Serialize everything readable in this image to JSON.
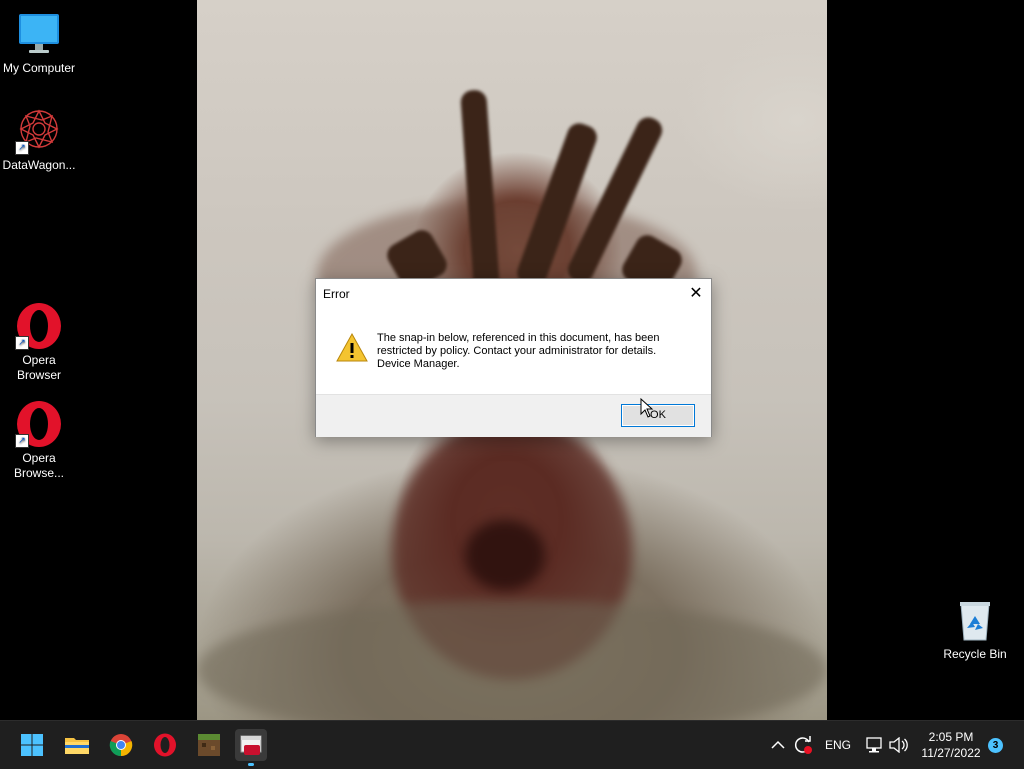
{
  "desktop": {
    "icons": [
      {
        "label": "My Computer",
        "icon": "monitor-icon"
      },
      {
        "label": "DataWagon...",
        "icon": "datawagon-icon"
      },
      {
        "label": "Opera Browser",
        "icon": "opera-icon"
      },
      {
        "label": "Opera Browse...",
        "icon": "opera-icon"
      },
      {
        "label": "Recycle Bin",
        "icon": "recycle-bin-icon"
      }
    ]
  },
  "dialog": {
    "title": "Error",
    "message": "The snap-in below, referenced in this document, has been restricted by policy. Contact your administrator for details.",
    "detail": "Device Manager.",
    "ok_label": "OK",
    "close_glyph": "✕"
  },
  "taskbar": {
    "apps": [
      {
        "name": "Start",
        "icon": "windows-start-icon"
      },
      {
        "name": "File Explorer",
        "icon": "folder-icon"
      },
      {
        "name": "Chrome",
        "icon": "chrome-icon"
      },
      {
        "name": "Opera",
        "icon": "opera-icon"
      },
      {
        "name": "Minecraft",
        "icon": "minecraft-icon"
      },
      {
        "name": "Active app",
        "icon": "app-window-icon"
      }
    ],
    "tray": {
      "language": "ENG",
      "time": "2:05 PM",
      "date": "11/27/2022",
      "notification_count": "3"
    }
  },
  "colors": {
    "accent": "#0078d7",
    "taskbar": "#1f1f1f",
    "badge": "#4cc2ff"
  }
}
